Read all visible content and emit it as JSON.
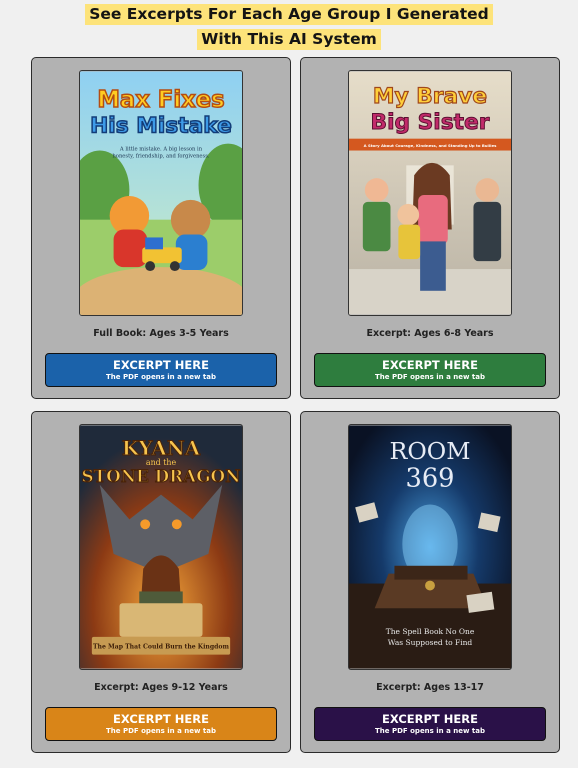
{
  "header": {
    "line1": "See Excerpts For Each Age Group I Generated",
    "line2": "With This AI System"
  },
  "cards": [
    {
      "title_line1": "Max Fixes",
      "title_line2": "His Mistake",
      "cover_tagline_1": "A little mistake. A big lesson in",
      "cover_tagline_2": "honesty, friendship, and forgiveness.",
      "label": "Full Book: Ages 3-5 Years",
      "button_title": "EXCERPT HERE",
      "button_sub": "The PDF opens in a new tab",
      "button_color": "#1b62aa"
    },
    {
      "title_line1": "My Brave",
      "title_line2": "Big Sister",
      "cover_tagline_1": "A Story About Courage, Kindness, and Standing Up to Bullies",
      "label": "Excerpt: Ages 6-8 Years",
      "button_title": "EXCERPT HERE",
      "button_sub": "The PDF opens in a new tab",
      "button_color": "#2e7d3e"
    },
    {
      "title_line1": "KYANA",
      "title_line_mid": "and the",
      "title_line2": "STONE DRAGON",
      "cover_tagline_1": "The Map That Could Burn the Kingdom",
      "label": "Excerpt: Ages 9-12 Years",
      "button_title": "EXCERPT HERE",
      "button_sub": "The PDF opens in a new tab",
      "button_color": "#d98518"
    },
    {
      "title_line1": "ROOM",
      "title_line2": "369",
      "cover_tagline_1": "The Spell Book No One",
      "cover_tagline_2": "Was Supposed to Find",
      "label": "Excerpt: Ages 13-17",
      "button_title": "EXCERPT HERE",
      "button_sub": "The PDF opens in a new tab",
      "button_color": "#2a1148"
    }
  ]
}
